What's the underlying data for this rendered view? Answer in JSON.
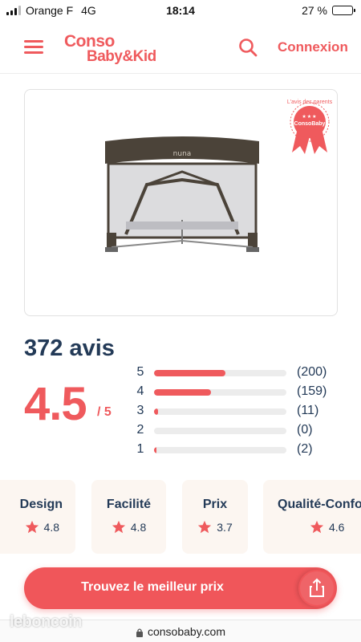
{
  "status_bar": {
    "carrier": "Orange F",
    "network": "4G",
    "time": "18:14",
    "battery_text": "27 %",
    "battery_level": 0.27
  },
  "header": {
    "logo_line1": "Conso",
    "logo_line2": "Baby&Kid",
    "login_label": "Connexion",
    "menu_icon": "hamburger-icon",
    "search_icon": "search-icon"
  },
  "product": {
    "image_alt_icon": "travel-cot-image",
    "brand_mark": "nuna",
    "badge": {
      "ring_text": "L'avis des parents",
      "label": "ConsoBaby",
      "stars": "★★★"
    }
  },
  "reviews": {
    "count_text": "372 avis",
    "score": "4.5",
    "score_max": "/ 5",
    "distribution": [
      {
        "stars": "5",
        "count": 200,
        "count_text": "(200)"
      },
      {
        "stars": "4",
        "count": 159,
        "count_text": "(159)"
      },
      {
        "stars": "3",
        "count": 11,
        "count_text": "(11)"
      },
      {
        "stars": "2",
        "count": 0,
        "count_text": "(0)"
      },
      {
        "stars": "1",
        "count": 2,
        "count_text": "(2)"
      }
    ],
    "distribution_max": 372
  },
  "criteria": [
    {
      "name": "Design",
      "value": "4.8"
    },
    {
      "name": "Facilité",
      "value": "4.8"
    },
    {
      "name": "Prix",
      "value": "3.7"
    },
    {
      "name": "Qualité-Confort",
      "value": "4.6"
    }
  ],
  "cta": {
    "label": "Trouvez le meilleur prix",
    "share_icon": "share-icon"
  },
  "url_bar": {
    "domain": "consobaby.com",
    "lock_icon": "lock-icon"
  },
  "watermark": "leboncoin",
  "colors": {
    "accent": "#ef5a5d",
    "text_dark": "#233a57",
    "card_bg": "#fcf6f1"
  }
}
